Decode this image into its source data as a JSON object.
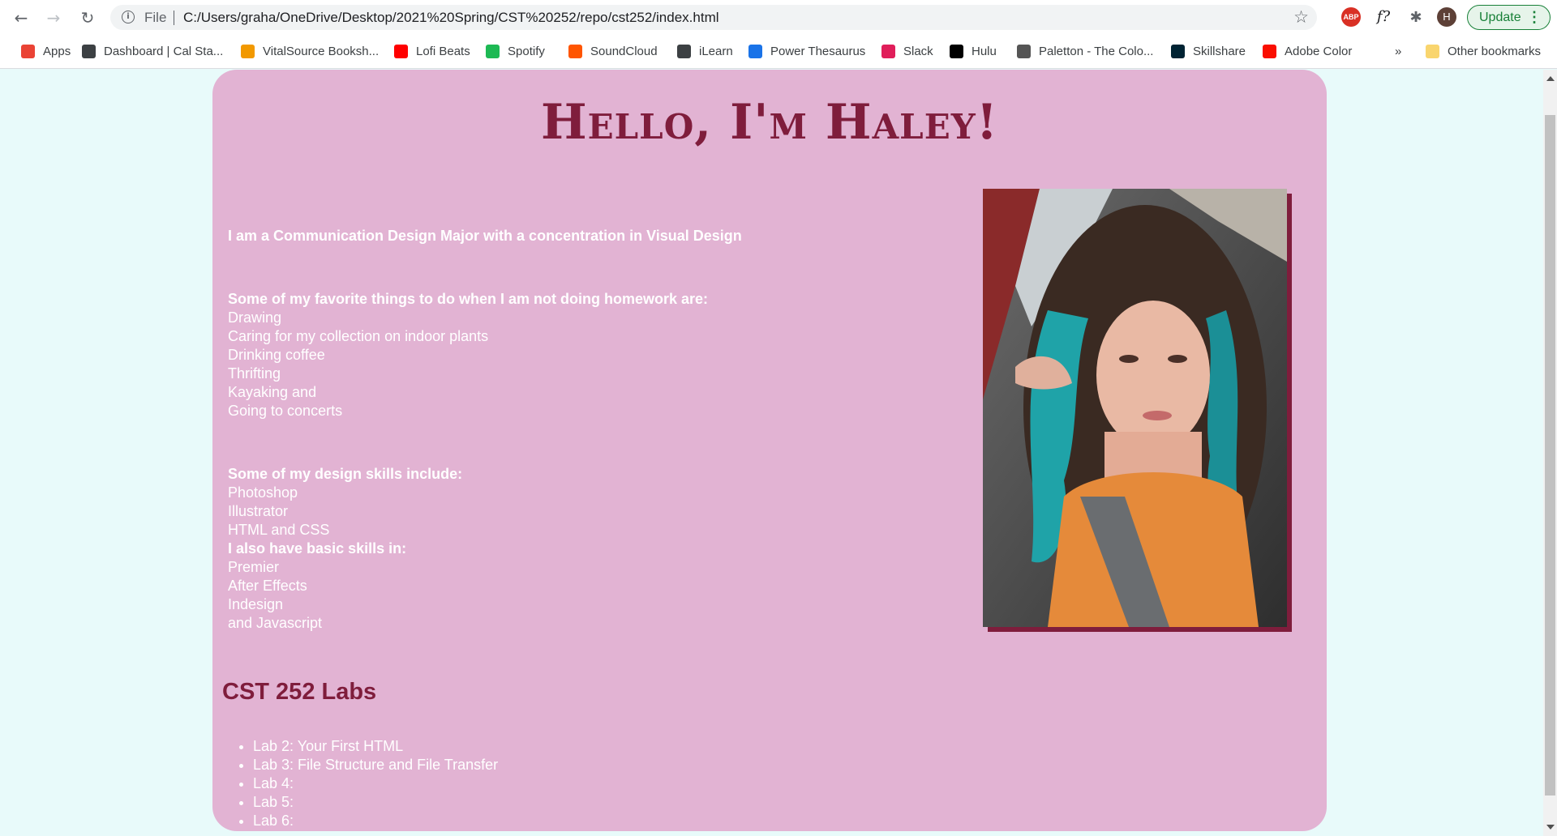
{
  "browser": {
    "url_scheme": "File",
    "url": "C:/Users/graha/OneDrive/Desktop/2021%20Spring/CST%20252/repo/cst252/index.html",
    "profile_initial": "H",
    "update_label": "Update",
    "ext_abp": "ABP",
    "ext_font": "f?",
    "bookmarks": [
      {
        "label": "Apps",
        "icon": "apps-grid-icon",
        "color": "#ea4335"
      },
      {
        "label": "Dashboard | Cal Sta...",
        "icon": "canvas-icon",
        "color": "#3c4043"
      },
      {
        "label": "VitalSource Booksh...",
        "icon": "vitalsource-icon",
        "color": "#f29900"
      },
      {
        "label": "Lofi Beats",
        "icon": "youtube-icon",
        "color": "#ff0000"
      },
      {
        "label": "Spotify",
        "icon": "spotify-icon",
        "color": "#1db954"
      },
      {
        "label": "SoundCloud",
        "icon": "soundcloud-icon",
        "color": "#ff5500"
      },
      {
        "label": "iLearn",
        "icon": "canvas-icon",
        "color": "#3c4043"
      },
      {
        "label": "Power Thesaurus",
        "icon": "power-thesaurus-icon",
        "color": "#1a73e8"
      },
      {
        "label": "Slack",
        "icon": "slack-icon",
        "color": "#e01e5a"
      },
      {
        "label": "Hulu",
        "icon": "hulu-icon",
        "color": "#000000"
      },
      {
        "label": "Paletton - The Colo...",
        "icon": "paletton-icon",
        "color": "#555555"
      },
      {
        "label": "Skillshare",
        "icon": "skillshare-icon",
        "color": "#002333"
      },
      {
        "label": "Adobe Color",
        "icon": "adobe-icon",
        "color": "#fa0f00"
      }
    ],
    "more_label": "»",
    "other_bookmarks": "Other bookmarks"
  },
  "page": {
    "heading": "Hello, I'm Haley!",
    "intro": "I am a Communication Design Major with a concentration in Visual Design",
    "favorites_heading": "Some of my favorite things to do when I am not doing homework are:",
    "favorites": [
      "Drawing",
      "Caring for my collection on indoor plants",
      "Drinking coffee",
      "Thrifting",
      "Kayaking and",
      "Going to concerts"
    ],
    "skills_heading": "Some of my design skills include:",
    "skills": [
      "Photoshop",
      "Illustrator",
      "HTML and CSS"
    ],
    "basic_heading": "I also have basic skills in:",
    "basic_skills": [
      "Premier",
      "After Effects",
      "Indesign",
      "and Javascript"
    ],
    "labs_title": "CST 252 Labs",
    "labs": [
      "Lab 2: Your First HTML",
      "Lab 3: File Structure and File Transfer",
      "Lab 4:",
      "Lab 5:",
      "Lab 6:"
    ]
  },
  "colors": {
    "background": "#e8fafa",
    "card": "#e2b3d3",
    "accent": "#7f1d3c",
    "text": "#ffffff"
  }
}
